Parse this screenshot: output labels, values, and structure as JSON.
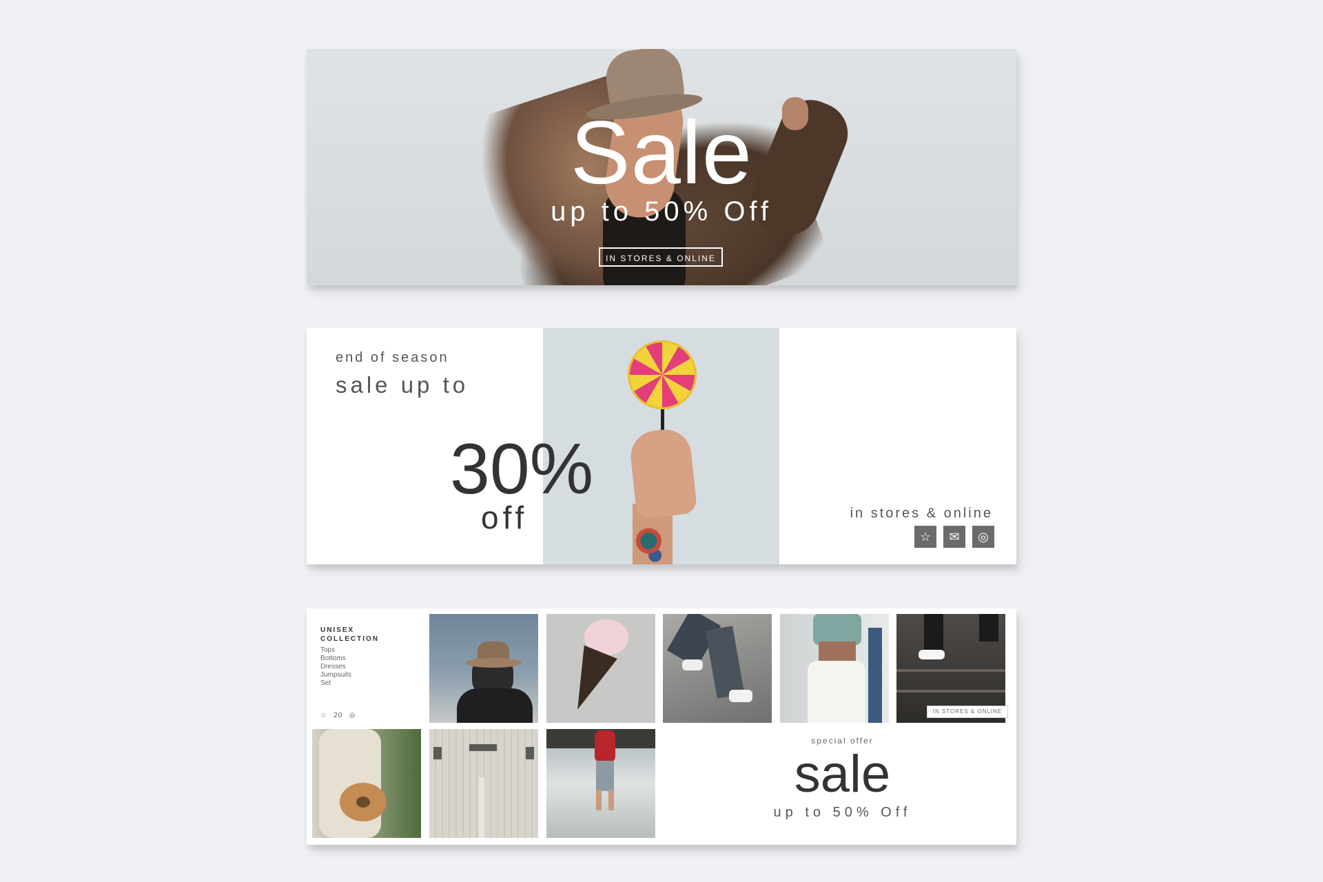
{
  "banner1": {
    "headline": "Sale",
    "subline": "up to 50% Off",
    "button_label": "IN STORES & ONLINE"
  },
  "banner2": {
    "eyebrow": "end of season",
    "line2": "sale up to",
    "percent": "30%",
    "off": "off",
    "channels": "in stores & online",
    "icons": [
      "star-icon",
      "envelope-icon",
      "globe-icon"
    ]
  },
  "banner3": {
    "collection_title_1": "UNISEX",
    "collection_title_2": "COLLECTION",
    "categories": [
      "Tops",
      "Bottoms",
      "Dresses",
      "Jumpsuits",
      "Set"
    ],
    "footer_icons": [
      "star-icon",
      "20",
      "globe-icon"
    ],
    "ribbon": "IN STORES & ONLINE",
    "special_offer": "special offer",
    "headline": "sale",
    "subline": "up to 50% Off"
  },
  "colors": {
    "background": "#eef0f4",
    "banner_photo_bg": "#d8dcde",
    "icon_box": "#6b6b6b"
  }
}
